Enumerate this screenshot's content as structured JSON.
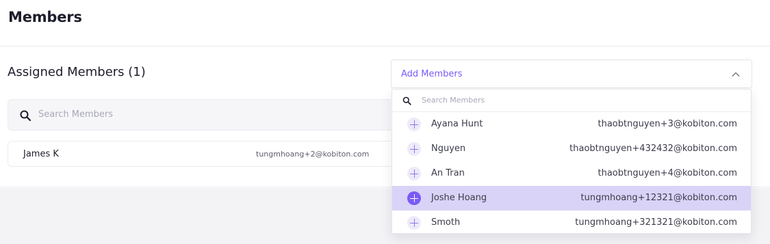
{
  "header": {
    "title": "Members"
  },
  "assigned": {
    "title": "Assigned Members (1)",
    "search_placeholder": "Search Members",
    "members": [
      {
        "name": "James K",
        "email": "tungmhoang+2@kobiton.com"
      }
    ]
  },
  "add_members": {
    "label": "Add Members",
    "search_placeholder": "Search Members",
    "options": [
      {
        "name": "Ayana Hunt",
        "email": "thaobtnguyen+3@kobiton.com"
      },
      {
        "name": "Nguyen",
        "email": "thaobtnguyen+432432@kobiton.com"
      },
      {
        "name": "An Tran",
        "email": "thaobtnguyen+4@kobiton.com"
      },
      {
        "name": "Joshe Hoang",
        "email": "tungmhoang+12321@kobiton.com"
      },
      {
        "name": "Smoth",
        "email": "tungmhoang+321321@kobiton.com"
      }
    ],
    "highlighted_index": 3
  },
  "colors": {
    "accent": "#7a5af8",
    "highlight": "#d9d3f7",
    "icons": [
      "search-icon",
      "chevron-up-icon",
      "plus-icon"
    ]
  }
}
